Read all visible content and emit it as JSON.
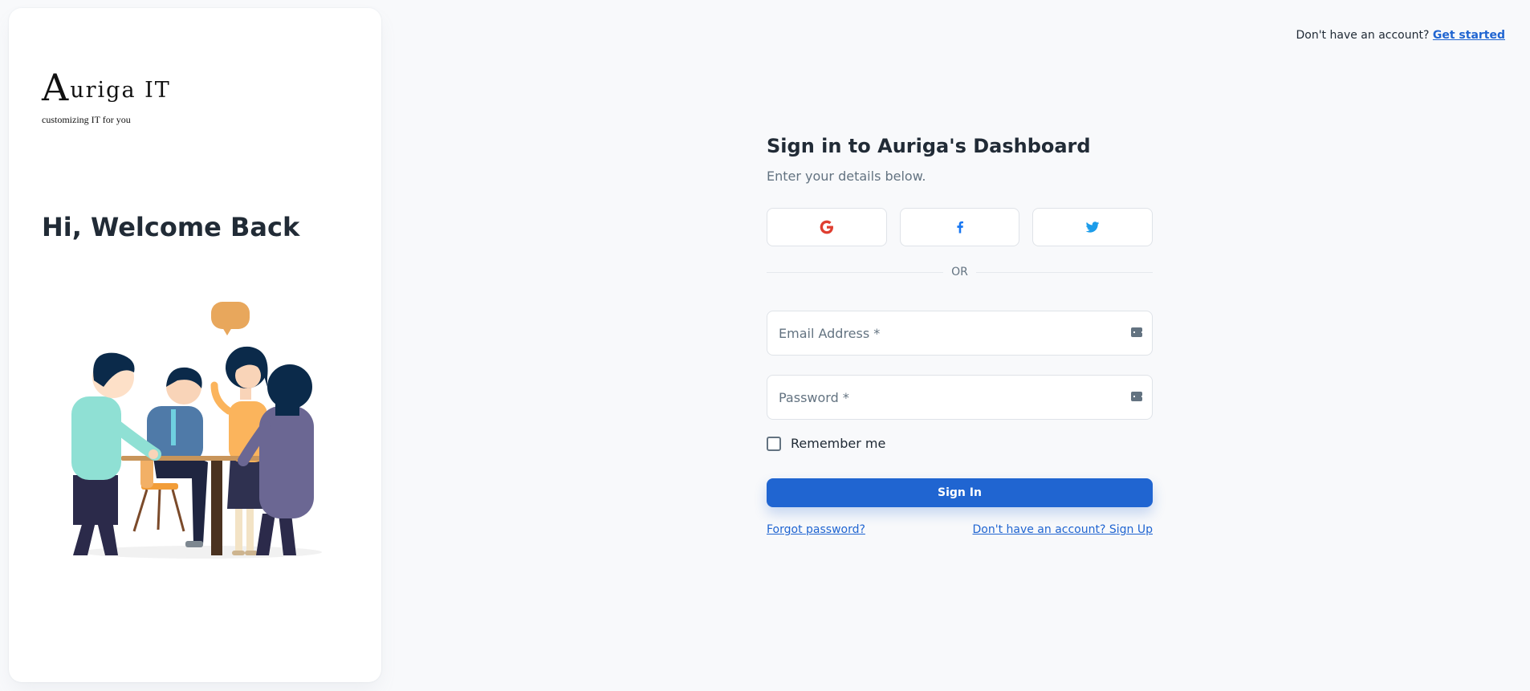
{
  "brand": {
    "logo_initial": "A",
    "logo_rest": "uriga IT",
    "tagline": "customizing IT for you"
  },
  "welcome": {
    "heading": "Hi, Welcome Back"
  },
  "topbar": {
    "prompt": "Don't have an account?",
    "cta": "Get started"
  },
  "form": {
    "title": "Sign in to Auriga's Dashboard",
    "subtitle": "Enter your details below.",
    "social": [
      {
        "icon": "google-icon",
        "color": "#DF3E30"
      },
      {
        "icon": "facebook-icon",
        "color": "#1877F2"
      },
      {
        "icon": "twitter-icon",
        "color": "#1C9CEA"
      }
    ],
    "divider_text": "OR",
    "email": {
      "placeholder": "Email Address *",
      "value": ""
    },
    "password": {
      "placeholder": "Password *",
      "value": ""
    },
    "remember_label": "Remember me",
    "remember_checked": false,
    "submit_label": "Sign In",
    "forgot_label": "Forgot password?",
    "signup_label": "Don't have an account? Sign Up"
  },
  "colors": {
    "primary": "#2065d1",
    "background": "#f8f9fb",
    "text": "#212b36",
    "muted": "#637381"
  }
}
